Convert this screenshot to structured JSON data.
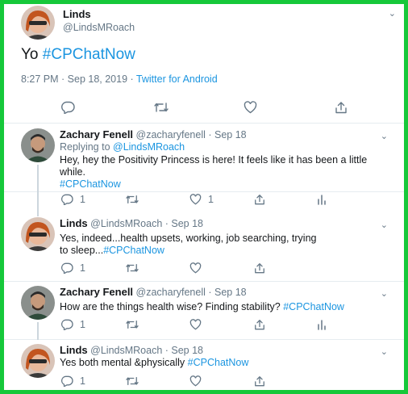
{
  "main_tweet": {
    "name": "Linds",
    "handle": "@LindsMRoach",
    "text_prefix": "Yo ",
    "hashtag": "#CPChatNow",
    "time": "8:27 PM · Sep 18, 2019 · ",
    "source": "Twitter for Android",
    "icons": [
      "reply-icon",
      "retweet-icon",
      "like-icon",
      "share-icon"
    ]
  },
  "replies": [
    {
      "name": "Zachary Fenell",
      "handle": "@zacharyfenell",
      "date": " · Sep 18",
      "replying_prefix": "Replying to ",
      "replying_to": "@LindsMRoach",
      "text": "Hey, hey the Positivity Princess is here! It feels like it has been a little while.",
      "hashtag": "#CPChatNow",
      "reply_count": "1",
      "like_count": "1"
    },
    {
      "name": "Linds",
      "handle": "@LindsMRoach",
      "date": " · Sep 18",
      "text": "Yes, indeed...health upsets, working, job searching, trying to sleep...",
      "hashtag": "#CPChatNow",
      "reply_count": "1"
    },
    {
      "name": "Zachary Fenell",
      "handle": "@zacharyfenell",
      "date": " · Sep 18",
      "text": "How are the things health wise? Finding stability? ",
      "hashtag": "#CPChatNow",
      "reply_count": "1"
    },
    {
      "name": "Linds",
      "handle": "@LindsMRoach",
      "date": " · Sep 18",
      "text": "Yes both mental &physically ",
      "hashtag": "#CPChatNow",
      "reply_count": "1"
    }
  ],
  "colors": {
    "border": "#16c83a",
    "link": "#1b95e0",
    "muted": "#657786",
    "divider": "#e6ecf0"
  }
}
